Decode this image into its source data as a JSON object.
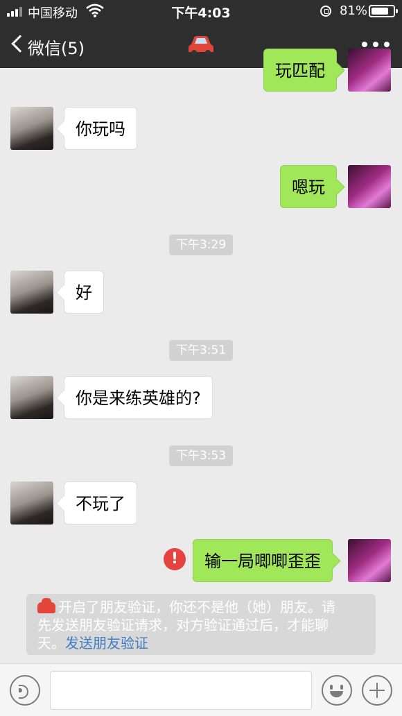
{
  "status_bar": {
    "carrier": "中国移动",
    "time": "下午4:03",
    "battery": "81%",
    "battery_level": 0.81
  },
  "nav": {
    "back_label": "微信(5)",
    "title_icon": "car-emoji-icon",
    "more_icon": "more-dots-icon"
  },
  "messages": [
    {
      "side": "right",
      "text": "玩匹配"
    },
    {
      "side": "left",
      "text": "你玩吗"
    },
    {
      "side": "right",
      "text": "嗯玩"
    },
    {
      "type": "time",
      "text": "下午3:29"
    },
    {
      "side": "left",
      "text": "好"
    },
    {
      "type": "time",
      "text": "下午3:51"
    },
    {
      "side": "left",
      "text": "你是来练英雄的?"
    },
    {
      "type": "time",
      "text": "下午3:53"
    },
    {
      "side": "left",
      "text": "不玩了"
    },
    {
      "side": "right",
      "text": "输一局唧唧歪歪",
      "failed": true,
      "error_icon": "!"
    }
  ],
  "notice": {
    "icon": "car-emoji-icon",
    "line1": "开启了朋友验证，你还不是他（她）朋友。请",
    "line2": "先发送朋友验证请求，对方验证通过后，才能聊",
    "line3": "天。",
    "link": "发送朋友验证"
  },
  "input_bar": {
    "voice_icon": "voice-icon",
    "emoji_icon": "emoji-icon",
    "plus_icon": "plus-icon"
  },
  "colors": {
    "nav_bg": "#2e2e2e",
    "chat_bg": "#ebebeb",
    "my_bubble": "#a0e75a",
    "their_bubble": "#ffffff",
    "error": "#e64340",
    "link": "#3f7cc4"
  }
}
